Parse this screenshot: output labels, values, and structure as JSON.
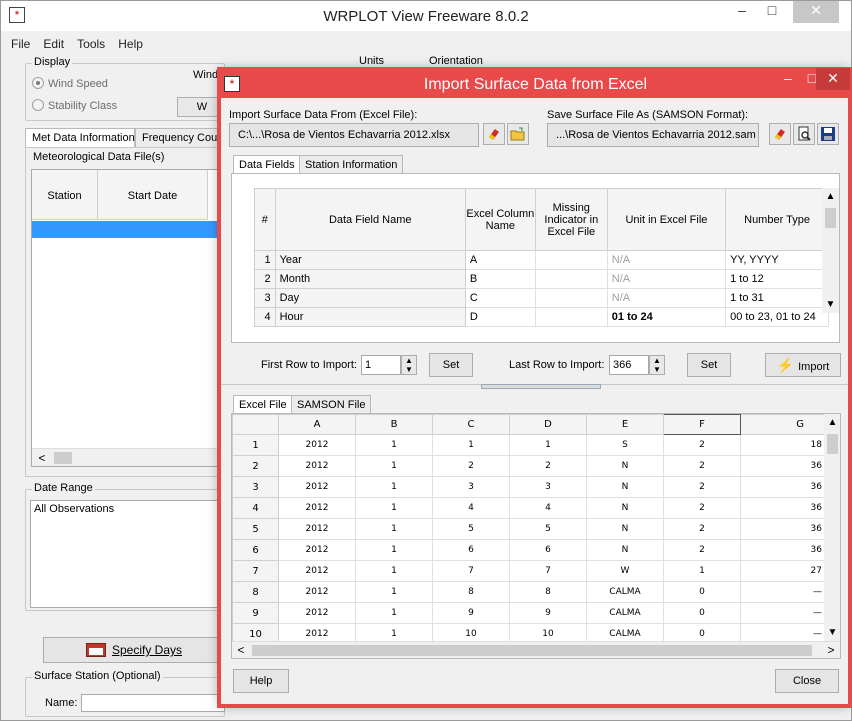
{
  "main": {
    "title": "WRPLOT View Freeware 8.0.2",
    "app_icon": "*",
    "window_controls": {
      "minimize": "–",
      "maximize": "□",
      "close": "✕"
    },
    "menu": [
      "File",
      "Edit",
      "Tools",
      "Help"
    ],
    "display_group": {
      "label": "Display",
      "options": [
        "Wind Speed",
        "Stability Class"
      ],
      "selected": "Wind Speed"
    },
    "wind_label": "Wind",
    "w_button": "W",
    "units_label": "Units",
    "orientation_label": "Orientation",
    "tabs": [
      "Met Data Information",
      "Frequency Cou"
    ],
    "met_group_label": "Meteorological Data File(s)",
    "met_columns": [
      "Station",
      "Start Date"
    ],
    "scroll_left": "<",
    "date_range_label": "Date Range",
    "date_range_value": "All Observations",
    "specify_days": "Specify Days",
    "surface_station_label": "Surface Station (Optional)",
    "name_label": "Name:"
  },
  "dialog": {
    "title": "Import Surface Data from Excel",
    "app_icon": "*",
    "window_controls": {
      "minimize": "–",
      "maximize": "□",
      "close": "✕"
    },
    "import_label": "Import Surface Data From (Excel File):",
    "import_path": "C:\\...\\Rosa de Vientos Echavarria 2012.xlsx",
    "save_label": "Save Surface File As (SAMSON Format):",
    "save_path": "...\\Rosa de Vientos Echavarria 2012.sam",
    "tabs": [
      "Data Fields",
      "Station Information"
    ],
    "fields_headers": [
      "#",
      "Data Field Name",
      "Excel Column Name",
      "Missing Indicator in Excel File",
      "Unit in Excel File",
      "Number Type"
    ],
    "fields_rows": [
      {
        "num": "1",
        "name": "Year",
        "column": "A",
        "missing": "",
        "unit": "N/A",
        "type": "YY, YYYY"
      },
      {
        "num": "2",
        "name": "Month",
        "column": "B",
        "missing": "",
        "unit": "N/A",
        "type": "1 to 12"
      },
      {
        "num": "3",
        "name": "Day",
        "column": "C",
        "missing": "",
        "unit": "N/A",
        "type": "1 to 31"
      },
      {
        "num": "4",
        "name": "Hour",
        "column": "D",
        "missing": "",
        "unit": "01 to 24",
        "type": "00 to 23, 01 to 24"
      }
    ],
    "first_row_label": "First Row to Import:",
    "first_row_value": "1",
    "last_row_label": "Last Row to Import:",
    "last_row_value": "366",
    "set_label": "Set",
    "import_button": "Import",
    "sheet_tabs": [
      "Excel File",
      "SAMSON File"
    ],
    "sheet_columns": [
      "",
      "A",
      "B",
      "C",
      "D",
      "E",
      "F",
      "G"
    ],
    "sheet_rows": [
      [
        "1",
        "2012",
        "1",
        "1",
        "1",
        "S",
        "2",
        "18"
      ],
      [
        "2",
        "2012",
        "1",
        "2",
        "2",
        "N",
        "2",
        "36"
      ],
      [
        "3",
        "2012",
        "1",
        "3",
        "3",
        "N",
        "2",
        "36"
      ],
      [
        "4",
        "2012",
        "1",
        "4",
        "4",
        "N",
        "2",
        "36"
      ],
      [
        "5",
        "2012",
        "1",
        "5",
        "5",
        "N",
        "2",
        "36"
      ],
      [
        "6",
        "2012",
        "1",
        "6",
        "6",
        "N",
        "2",
        "36"
      ],
      [
        "7",
        "2012",
        "1",
        "7",
        "7",
        "W",
        "1",
        "27"
      ],
      [
        "8",
        "2012",
        "1",
        "8",
        "8",
        "CALMA",
        "0",
        "—"
      ],
      [
        "9",
        "2012",
        "1",
        "9",
        "9",
        "CALMA",
        "0",
        "—"
      ],
      [
        "10",
        "2012",
        "1",
        "10",
        "10",
        "CALMA",
        "0",
        "—"
      ]
    ],
    "help_button": "Help",
    "close_button": "Close"
  },
  "icons": {
    "scroll_up": "▲",
    "scroll_down": "▼",
    "scroll_left": "<",
    "scroll_right": ">",
    "spin_up": "▲",
    "spin_down": "▼"
  },
  "colors": {
    "dialog_accent": "#e84a4a",
    "selection": "#3399ff"
  }
}
